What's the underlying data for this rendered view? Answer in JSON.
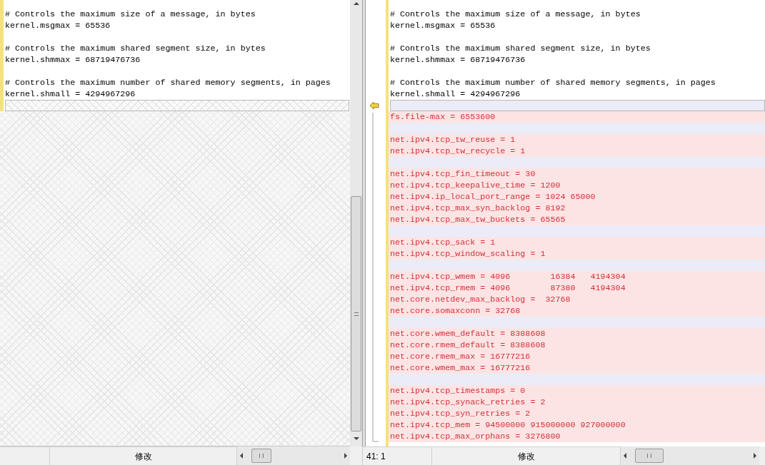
{
  "left_pane": {
    "lines": [
      {
        "kind": "text",
        "text": "# Controls the maximum size of a message, in bytes"
      },
      {
        "kind": "text",
        "text": "kernel.msgmax = 65536"
      },
      {
        "kind": "empty"
      },
      {
        "kind": "text",
        "text": "# Controls the maximum shared segment size, in bytes"
      },
      {
        "kind": "text",
        "text": "kernel.shmmax = 68719476736"
      },
      {
        "kind": "empty"
      },
      {
        "kind": "text",
        "text": "# Controls the maximum number of shared memory segments, in pages"
      },
      {
        "kind": "text",
        "text": "kernel.shmall = 4294967296"
      },
      {
        "kind": "placeholder"
      }
    ]
  },
  "right_pane": {
    "lines": [
      {
        "kind": "text",
        "text": "# Controls the maximum size of a message, in bytes"
      },
      {
        "kind": "text",
        "text": "kernel.msgmax = 65536"
      },
      {
        "kind": "empty"
      },
      {
        "kind": "text",
        "text": "# Controls the maximum shared segment size, in bytes"
      },
      {
        "kind": "text",
        "text": "kernel.shmmax = 68719476736"
      },
      {
        "kind": "empty"
      },
      {
        "kind": "text",
        "text": "# Controls the maximum number of shared memory segments, in pages"
      },
      {
        "kind": "text",
        "text": "kernel.shmall = 4294967296"
      },
      {
        "kind": "placeholder"
      },
      {
        "kind": "added",
        "text": "fs.file-max = 6553600"
      },
      {
        "kind": "gap"
      },
      {
        "kind": "added",
        "text": "net.ipv4.tcp_tw_reuse = 1"
      },
      {
        "kind": "added",
        "text": "net.ipv4.tcp_tw_recycle = 1"
      },
      {
        "kind": "gap"
      },
      {
        "kind": "added",
        "text": "net.ipv4.tcp_fin_timeout = 30"
      },
      {
        "kind": "added",
        "text": "net.ipv4.tcp_keepalive_time = 1200"
      },
      {
        "kind": "added",
        "text": "net.ipv4.ip_local_port_range = 1024 65000"
      },
      {
        "kind": "added",
        "text": "net.ipv4.tcp_max_syn_backlog = 8192"
      },
      {
        "kind": "added",
        "text": "net.ipv4.tcp_max_tw_buckets = 65565"
      },
      {
        "kind": "gap"
      },
      {
        "kind": "added",
        "text": "net.ipv4.tcp_sack = 1"
      },
      {
        "kind": "added",
        "text": "net.ipv4.tcp_window_scaling = 1"
      },
      {
        "kind": "gap"
      },
      {
        "kind": "added",
        "text": "net.ipv4.tcp_wmem = 4096        16384   4194304"
      },
      {
        "kind": "added",
        "text": "net.ipv4.tcp_rmem = 4096        87380   4194304"
      },
      {
        "kind": "added",
        "text": "net.core.netdev_max_backlog =  32768"
      },
      {
        "kind": "added",
        "text": "net.core.somaxconn = 32768"
      },
      {
        "kind": "gap"
      },
      {
        "kind": "added",
        "text": "net.core.wmem_default = 8388608"
      },
      {
        "kind": "added",
        "text": "net.core.rmem_default = 8388608"
      },
      {
        "kind": "added",
        "text": "net.core.rmem_max = 16777216"
      },
      {
        "kind": "added",
        "text": "net.core.wmem_max = 16777216"
      },
      {
        "kind": "gap"
      },
      {
        "kind": "added",
        "text": "net.ipv4.tcp_timestamps = 0"
      },
      {
        "kind": "added",
        "text": "net.ipv4.tcp_synack_retries = 2"
      },
      {
        "kind": "added",
        "text": "net.ipv4.tcp_syn_retries = 2"
      },
      {
        "kind": "added",
        "text": "net.ipv4.tcp_mem = 94500000 915000000 927000000"
      },
      {
        "kind": "added",
        "text": "net.ipv4.tcp_max_orphans = 3276800"
      }
    ]
  },
  "left_status": {
    "mode": "修改"
  },
  "right_status": {
    "position": "41: 1",
    "mode": "修改"
  }
}
